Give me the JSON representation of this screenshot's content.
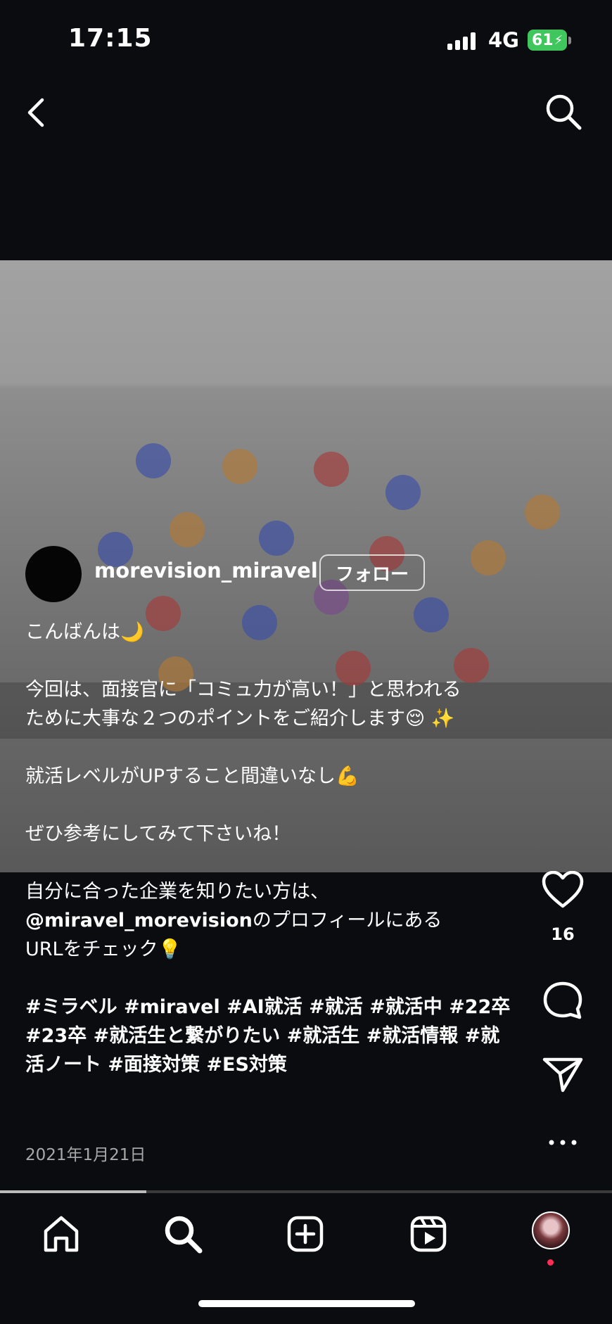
{
  "status_bar": {
    "time": "17:15",
    "network": "4G",
    "battery": "61"
  },
  "post": {
    "username": "morevision_miravel",
    "follow_label": "フォロー",
    "caption": {
      "line1": "こんばんは🌙",
      "line2": "今回は、面接官に「コミュ力が高い！」と思われる",
      "line3": "ために大事な２つのポイントをご紹介します😌 ✨",
      "line4": "就活レベルがUPすること間違いなし💪",
      "line5": "ぜひ参考にしてみて下さいね！",
      "line6": "自分に合った企業を知りたい方は、",
      "line7_mention": "@miravel_morevision",
      "line7_rest": "のプロフィールにある",
      "line8": "URLをチェック💡",
      "hashtags": "#ミラベル #miravel #AI就活 #就活 #就活中 #22卒 #23卒 #就活生と繋がりたい #就活生 #就活情報 #就活ノート #面接対策 #ES対策"
    },
    "date": "2021年1月21日",
    "like_count": "16"
  },
  "tabs": [
    "home-icon",
    "search-icon",
    "create-icon",
    "reels-icon",
    "profile-avatar"
  ],
  "colors": {
    "background": "#0a0c10",
    "battery": "#3fc65c",
    "notification": "#ff2d55"
  }
}
